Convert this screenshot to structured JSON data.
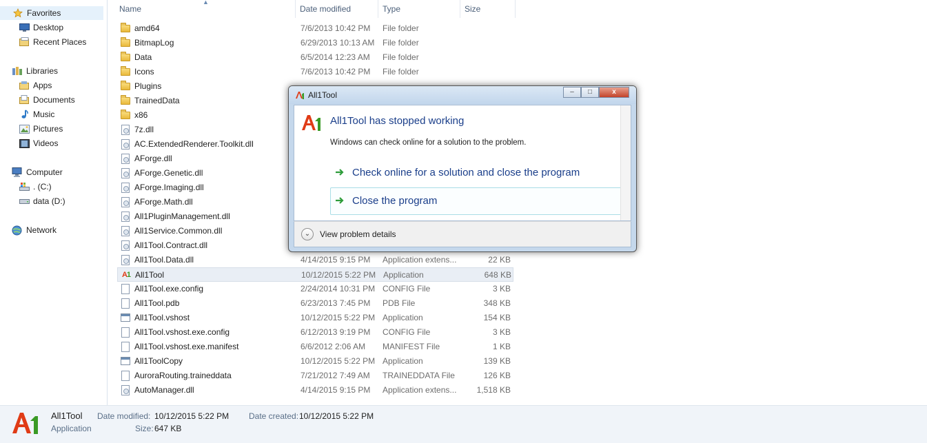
{
  "nav": {
    "favorites": "Favorites",
    "desktop": "Desktop",
    "recent_places": "Recent Places",
    "libraries": "Libraries",
    "apps": "Apps",
    "documents": "Documents",
    "music": "Music",
    "pictures": "Pictures",
    "videos": "Videos",
    "computer": "Computer",
    "drive_c": ". (C:)",
    "drive_d": "data (D:)",
    "network": "Network"
  },
  "columns": {
    "name": "Name",
    "date": "Date modified",
    "type": "Type",
    "size": "Size"
  },
  "files": [
    {
      "name": "amd64",
      "date": "7/6/2013 10:42 PM",
      "type": "File folder",
      "size": "",
      "icon": "folder-icon"
    },
    {
      "name": "BitmapLog",
      "date": "6/29/2013 10:13 AM",
      "type": "File folder",
      "size": "",
      "icon": "folder-icon"
    },
    {
      "name": "Data",
      "date": "6/5/2014 12:23 AM",
      "type": "File folder",
      "size": "",
      "icon": "folder-icon"
    },
    {
      "name": "Icons",
      "date": "7/6/2013 10:42 PM",
      "type": "File folder",
      "size": "",
      "icon": "folder-icon"
    },
    {
      "name": "Plugins",
      "date": "",
      "type": "",
      "size": "",
      "icon": "folder-icon"
    },
    {
      "name": "TrainedData",
      "date": "",
      "type": "",
      "size": "",
      "icon": "folder-icon"
    },
    {
      "name": "x86",
      "date": "",
      "type": "",
      "size": "",
      "icon": "folder-icon"
    },
    {
      "name": "7z.dll",
      "date": "",
      "type": "",
      "size": "",
      "icon": "dll-icon"
    },
    {
      "name": "AC.ExtendedRenderer.Toolkit.dll",
      "date": "",
      "type": "",
      "size": "",
      "icon": "dll-icon"
    },
    {
      "name": "AForge.dll",
      "date": "",
      "type": "",
      "size": "",
      "icon": "dll-icon"
    },
    {
      "name": "AForge.Genetic.dll",
      "date": "",
      "type": "",
      "size": "",
      "icon": "dll-icon"
    },
    {
      "name": "AForge.Imaging.dll",
      "date": "",
      "type": "",
      "size": "",
      "icon": "dll-icon"
    },
    {
      "name": "AForge.Math.dll",
      "date": "",
      "type": "",
      "size": "",
      "icon": "dll-icon"
    },
    {
      "name": "All1PluginManagement.dll",
      "date": "",
      "type": "",
      "size": "",
      "icon": "dll-icon"
    },
    {
      "name": "All1Service.Common.dll",
      "date": "",
      "type": "",
      "size": "",
      "icon": "dll-icon"
    },
    {
      "name": "All1Tool.Contract.dll",
      "date": "",
      "type": "",
      "size": "",
      "icon": "dll-icon"
    },
    {
      "name": "All1Tool.Data.dll",
      "date": "4/14/2015 9:15 PM",
      "type": "Application extens...",
      "size": "22 KB",
      "icon": "dll-icon"
    },
    {
      "name": "All1Tool",
      "date": "10/12/2015 5:22 PM",
      "type": "Application",
      "size": "648 KB",
      "icon": "a1-app-icon"
    },
    {
      "name": "All1Tool.exe.config",
      "date": "2/24/2014 10:31 PM",
      "type": "CONFIG File",
      "size": "3 KB",
      "icon": "config-file-icon"
    },
    {
      "name": "All1Tool.pdb",
      "date": "6/23/2013 7:45 PM",
      "type": "PDB File",
      "size": "348 KB",
      "icon": "pdb-file-icon"
    },
    {
      "name": "All1Tool.vshost",
      "date": "10/12/2015 5:22 PM",
      "type": "Application",
      "size": "154 KB",
      "icon": "app-icon"
    },
    {
      "name": "All1Tool.vshost.exe.config",
      "date": "6/12/2013 9:19 PM",
      "type": "CONFIG File",
      "size": "3 KB",
      "icon": "config-file-icon"
    },
    {
      "name": "All1Tool.vshost.exe.manifest",
      "date": "6/6/2012 2:06 AM",
      "type": "MANIFEST File",
      "size": "1 KB",
      "icon": "manifest-file-icon"
    },
    {
      "name": "All1ToolCopy",
      "date": "10/12/2015 5:22 PM",
      "type": "Application",
      "size": "139 KB",
      "icon": "app-icon"
    },
    {
      "name": "AuroraRouting.traineddata",
      "date": "7/21/2012 7:49 AM",
      "type": "TRAINEDDATA File",
      "size": "126 KB",
      "icon": "data-file-icon"
    },
    {
      "name": "AutoManager.dll",
      "date": "4/14/2015 9:15 PM",
      "type": "Application extens...",
      "size": "1,518 KB",
      "icon": "dll-icon"
    }
  ],
  "details": {
    "name": "All1Tool",
    "kind": "Application",
    "date_modified_label": "Date modified:",
    "date_modified": "10/12/2015 5:22 PM",
    "date_created_label": "Date created:",
    "date_created": "10/12/2015 5:22 PM",
    "size_label": "Size:",
    "size": "647 KB"
  },
  "dialog": {
    "title": "All1Tool",
    "heading": "All1Tool has stopped working",
    "message": "Windows can check online for a solution to the problem.",
    "option_check": "Check online for a solution and close the program",
    "option_close": "Close the program",
    "details_toggle": "View problem details",
    "minimize": "–",
    "maximize": "□",
    "close": "x"
  },
  "logo": {
    "letter": "A",
    "digit": "1"
  },
  "colors": {
    "link_blue": "#1a3e8a",
    "selection": "#e9eef5",
    "details_bar": "#f0f4f9"
  }
}
